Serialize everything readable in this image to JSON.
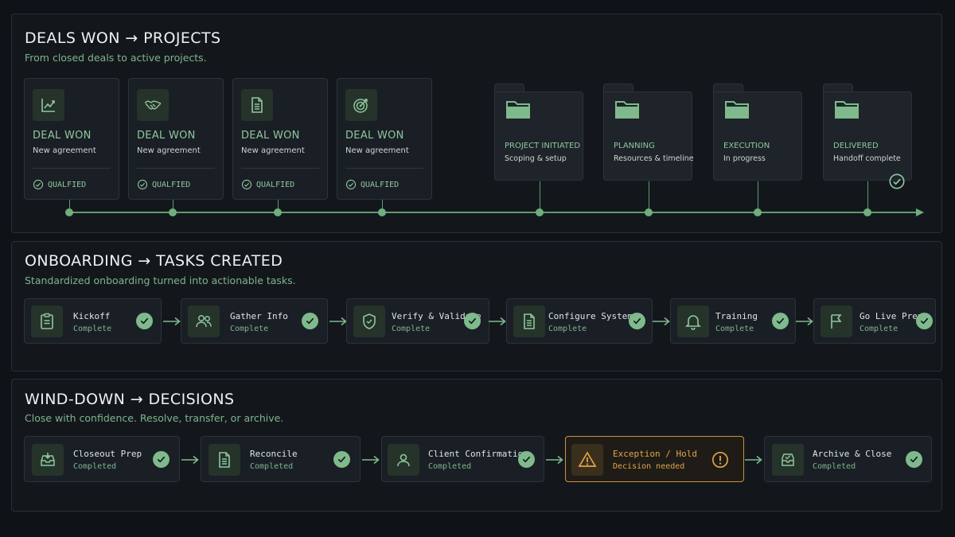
{
  "colors": {
    "accent": "#7fba8c",
    "warning": "#e0a54b",
    "background": "#0f1216"
  },
  "section1": {
    "title": "DEALS WON → PROJECTS",
    "subtitle": "From closed deals to active projects.",
    "deals": [
      {
        "icon": "chart-icon",
        "title": "DEAL WON",
        "subtitle": "New agreement",
        "status": "QUALFIED"
      },
      {
        "icon": "handshake-icon",
        "title": "DEAL WON",
        "subtitle": "New agreement",
        "status": "QUALFIED"
      },
      {
        "icon": "document-icon",
        "title": "DEAL WON",
        "subtitle": "New agreement",
        "status": "QUALFIED"
      },
      {
        "icon": "target-icon",
        "title": "DEAL WON",
        "subtitle": "New agreement",
        "status": "QUALFIED"
      }
    ],
    "projects": [
      {
        "icon": "folder-icon",
        "title": "PROJECT INITIATED",
        "subtitle": "Scoping & setup"
      },
      {
        "icon": "folder-icon",
        "title": "PLANNING",
        "subtitle": "Resources & timeline"
      },
      {
        "icon": "folder-icon",
        "title": "EXECUTION",
        "subtitle": "In progress"
      },
      {
        "icon": "folder-icon",
        "title": "DELIVERED",
        "subtitle": "Handoff complete"
      }
    ]
  },
  "section2": {
    "title": "ONBOARDING → TASKS CREATED",
    "subtitle": "Standardized onboarding turned into actionable tasks.",
    "tasks": [
      {
        "icon": "clipboard-icon",
        "title": "Kickoff",
        "status": "Complete"
      },
      {
        "icon": "users-icon",
        "title": "Gather Info",
        "status": "Complete"
      },
      {
        "icon": "shield-icon",
        "title": "Verify & Validate",
        "status": "Complete"
      },
      {
        "icon": "document-icon",
        "title": "Configure Systems",
        "status": "Complete"
      },
      {
        "icon": "bell-icon",
        "title": "Training",
        "status": "Complete"
      },
      {
        "icon": "flag-icon",
        "title": "Go Live Prep",
        "status": "Complete"
      }
    ]
  },
  "section3": {
    "title": "WIND-DOWN → DECISIONS",
    "subtitle": "Close with confidence. Resolve, transfer, or archive.",
    "steps": [
      {
        "icon": "inbox-icon",
        "title": "Closeout Prep",
        "status": "Completed"
      },
      {
        "icon": "document-icon",
        "title": "Reconcile",
        "status": "Completed"
      },
      {
        "icon": "user-icon",
        "title": "Client Confirmation",
        "status": "Completed"
      },
      {
        "icon": "warning-icon",
        "title": "Exception / Hold",
        "status": "Decision needed"
      },
      {
        "icon": "archive-icon",
        "title": "Archive & Close",
        "status": "Completed"
      }
    ]
  }
}
